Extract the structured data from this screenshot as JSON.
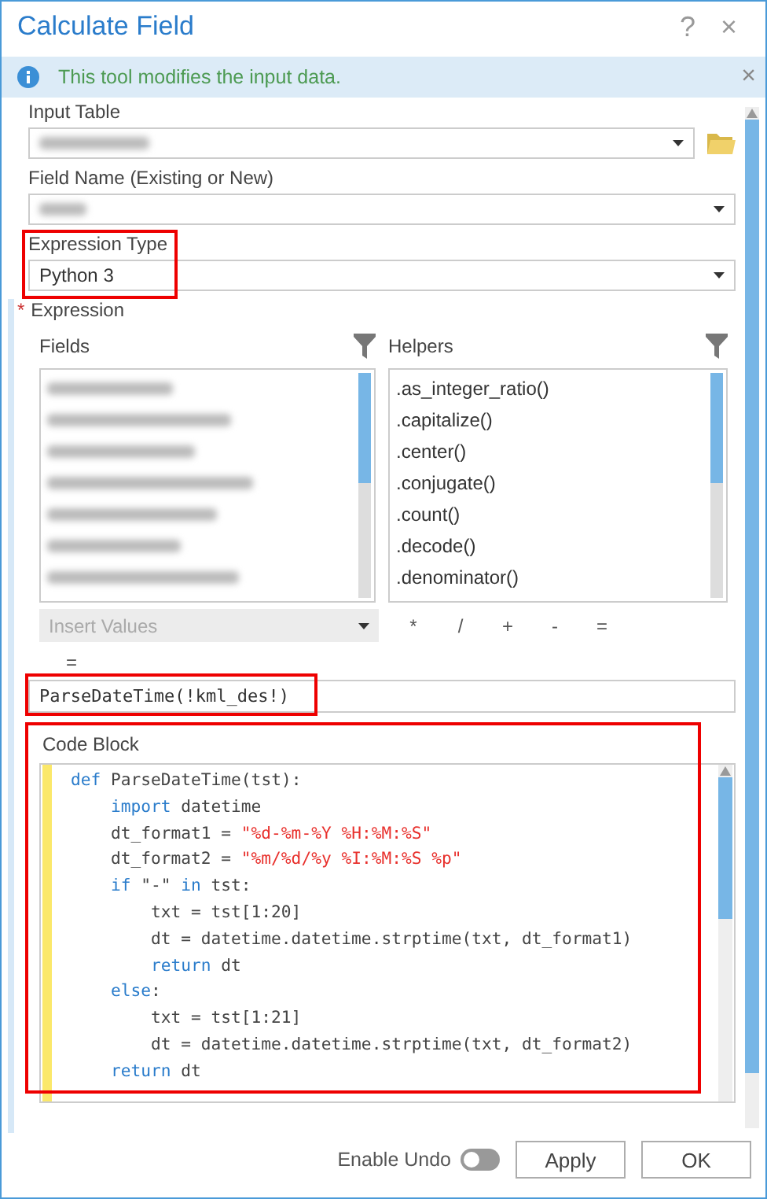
{
  "window": {
    "title": "Calculate Field",
    "help": "?",
    "close": "×"
  },
  "info_bar": {
    "message": "This tool modifies the input data.",
    "close": "×"
  },
  "input_table": {
    "label": "Input Table",
    "value_redacted": true
  },
  "field_name": {
    "label": "Field Name (Existing or New)",
    "value_redacted": true
  },
  "expression_type": {
    "label": "Expression Type",
    "value": "Python 3",
    "highlighted": true
  },
  "expression": {
    "required_mark": "*",
    "label": "Expression",
    "fields": {
      "label": "Fields",
      "items": [
        {
          "redacted": true
        },
        {
          "redacted": true
        },
        {
          "redacted": true
        },
        {
          "redacted": true
        },
        {
          "redacted": true
        },
        {
          "redacted": true
        },
        {
          "redacted": true
        }
      ]
    },
    "helpers": {
      "label": "Helpers",
      "items": [
        ".as_integer_ratio()",
        ".capitalize()",
        ".center()",
        ".conjugate()",
        ".count()",
        ".decode()",
        ".denominator()"
      ]
    },
    "insert_values": {
      "label": "Insert Values",
      "disabled": true
    },
    "operators": [
      "*",
      "/",
      "+",
      "-",
      "="
    ],
    "target_prefix": "=",
    "value": "ParseDateTime(!kml_des!)",
    "highlighted": true
  },
  "code_block": {
    "label": "Code Block",
    "highlighted": true,
    "lines": [
      {
        "tokens": [
          {
            "kind": "keyword",
            "text": "def"
          },
          {
            "kind": "plain",
            "text": " ParseDateTime(tst):"
          }
        ],
        "children": [
          {
            "tokens": [
              {
                "kind": "keyword",
                "text": "import"
              },
              {
                "kind": "plain",
                "text": " datetime"
              }
            ]
          },
          {
            "tokens": [
              {
                "kind": "plain",
                "text": "dt_format1 = "
              },
              {
                "kind": "string",
                "text": "\"%d-%m-%Y %H:%M:%S\""
              }
            ]
          },
          {
            "tokens": [
              {
                "kind": "plain",
                "text": "dt_format2 = "
              },
              {
                "kind": "string",
                "text": "\"%m/%d/%y %I:%M:%S %p\""
              }
            ]
          },
          {
            "tokens": [
              {
                "kind": "keyword",
                "text": "if"
              },
              {
                "kind": "plain",
                "text": " \"-\" "
              },
              {
                "kind": "keyword",
                "text": "in"
              },
              {
                "kind": "plain",
                "text": " tst:"
              }
            ],
            "children": [
              {
                "tokens": [
                  {
                    "kind": "plain",
                    "text": "txt = tst[1:20]"
                  }
                ]
              },
              {
                "tokens": [
                  {
                    "kind": "plain",
                    "text": "dt = datetime.datetime.strptime(txt, dt_format1)"
                  }
                ]
              },
              {
                "tokens": [
                  {
                    "kind": "keyword",
                    "text": "return"
                  },
                  {
                    "kind": "plain",
                    "text": " dt"
                  }
                ]
              }
            ]
          },
          {
            "tokens": [
              {
                "kind": "keyword",
                "text": "else"
              },
              {
                "kind": "plain",
                "text": ":"
              }
            ],
            "children": [
              {
                "tokens": [
                  {
                    "kind": "plain",
                    "text": "txt = tst[1:21]"
                  }
                ]
              },
              {
                "tokens": [
                  {
                    "kind": "plain",
                    "text": "dt = datetime.datetime.strptime(txt, dt_format2)"
                  }
                ]
              }
            ]
          },
          {
            "tokens": [
              {
                "kind": "keyword",
                "text": "return"
              },
              {
                "kind": "plain",
                "text": " dt"
              }
            ]
          }
        ]
      }
    ]
  },
  "footer": {
    "enable_undo": {
      "label": "Enable Undo",
      "on": false
    },
    "buttons": [
      "Apply",
      "OK"
    ]
  }
}
